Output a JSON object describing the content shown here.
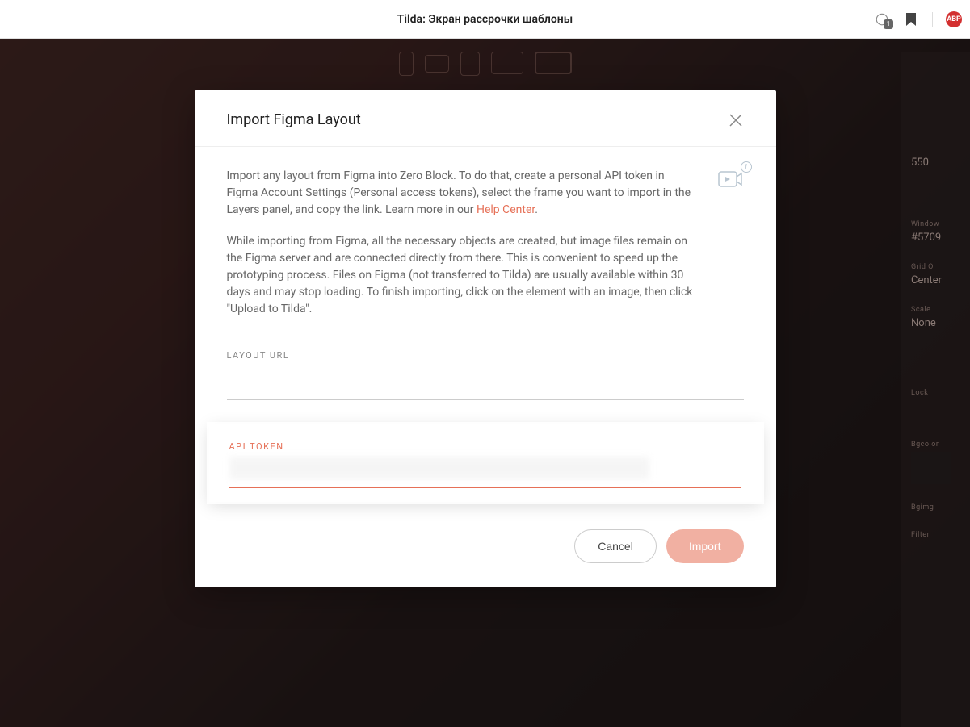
{
  "browser": {
    "page_title": "Tilda: Экран рассрочки шаблоны",
    "chat_badge": "1",
    "abp_label": "ABP"
  },
  "right_panel": {
    "height_label": "",
    "height_value": "550",
    "width_label": "Window",
    "width_id": "#5709",
    "grid_label": "Grid O",
    "grid_value": "Center",
    "scale_label": "Scale",
    "scale_value": "None",
    "lock_label": "Lock",
    "bgcolor_label": "Bgcolor",
    "bgimg_label": "Bgimg",
    "filter_label": "Filter"
  },
  "modal": {
    "title": "Import Figma Layout",
    "paragraph1_pre": "Import any layout from Figma into Zero Block. To do that, create a personal API token in Figma Account Settings (Personal access tokens), select the frame you want to import in the Layers panel, and copy the link. Learn more in our ",
    "help_link": "Help Center",
    "paragraph1_post": ".",
    "paragraph2": "While importing from Figma, all the necessary objects are created, but image files remain on the Figma server and are connected directly from there. This is convenient to speed up the prototyping process. Files on Figma (not transferred to Tilda) are usually available within 30 days and may stop loading. To finish importing, click on the element with an image, then click \"Upload to Tilda\".",
    "layout_url_label": "LAYOUT URL",
    "layout_url_value": "",
    "api_token_label": "API TOKEN",
    "cancel_label": "Cancel",
    "import_label": "Import"
  }
}
